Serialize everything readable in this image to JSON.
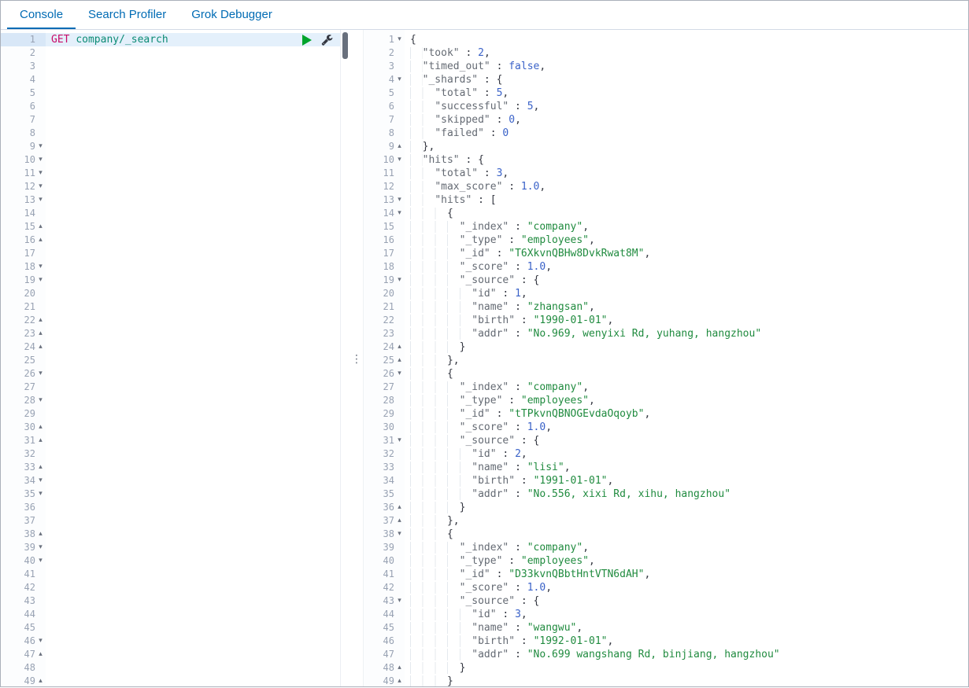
{
  "tabs": [
    {
      "label": "Console",
      "active": true
    },
    {
      "label": "Search Profiler",
      "active": false
    },
    {
      "label": "Grok Debugger",
      "active": false
    }
  ],
  "icons": {
    "grip": "⋮",
    "fold_down": "▾",
    "fold_up": "▴"
  },
  "colors": {
    "accent": "#006bb4",
    "border": "#d3dae6",
    "method": "#c80a68",
    "url": "#0c8b75",
    "key": "#646a73",
    "string": "#208b3f",
    "number": "#3a62c8",
    "bool": "#3a62c8",
    "punct": "#343741",
    "line_number": "#98a2b3",
    "fold": "#69707d",
    "active_line_bg": "#e4f0fb",
    "gutter_active_bg": "#d8e7f7",
    "play": "#00a42c",
    "icon": "#343741",
    "thumb": "#69707d",
    "indent_guide": "#e5e9ee"
  },
  "left_editor": {
    "line_count": 49,
    "active_line": 1,
    "request_tokens": [
      [
        "m",
        "GET"
      ],
      [
        "p",
        " "
      ],
      [
        "u",
        "company/_search"
      ]
    ],
    "folds": {
      "9": "down",
      "10": "down",
      "11": "down",
      "12": "down",
      "13": "down",
      "15": "up",
      "16": "up",
      "18": "down",
      "19": "down",
      "22": "up",
      "23": "up",
      "24": "up",
      "26": "down",
      "28": "down",
      "30": "up",
      "31": "up",
      "33": "up",
      "34": "down",
      "35": "down",
      "38": "up",
      "39": "down",
      "40": "down",
      "46": "down",
      "47": "up",
      "49": "up"
    }
  },
  "response": {
    "lines": [
      {
        "n": 1,
        "f": "down",
        "t": [
          [
            "p",
            "{"
          ]
        ]
      },
      {
        "n": 2,
        "t": [
          [
            "p",
            "  "
          ],
          [
            "k",
            "\"took\""
          ],
          [
            "p",
            " : "
          ],
          [
            "n",
            "2"
          ],
          [
            "p",
            ","
          ]
        ]
      },
      {
        "n": 3,
        "t": [
          [
            "p",
            "  "
          ],
          [
            "k",
            "\"timed_out\""
          ],
          [
            "p",
            " : "
          ],
          [
            "b",
            "false"
          ],
          [
            "p",
            ","
          ]
        ]
      },
      {
        "n": 4,
        "f": "down",
        "t": [
          [
            "p",
            "  "
          ],
          [
            "k",
            "\"_shards\""
          ],
          [
            "p",
            " : {"
          ]
        ]
      },
      {
        "n": 5,
        "t": [
          [
            "p",
            "    "
          ],
          [
            "k",
            "\"total\""
          ],
          [
            "p",
            " : "
          ],
          [
            "n",
            "5"
          ],
          [
            "p",
            ","
          ]
        ]
      },
      {
        "n": 6,
        "t": [
          [
            "p",
            "    "
          ],
          [
            "k",
            "\"successful\""
          ],
          [
            "p",
            " : "
          ],
          [
            "n",
            "5"
          ],
          [
            "p",
            ","
          ]
        ]
      },
      {
        "n": 7,
        "t": [
          [
            "p",
            "    "
          ],
          [
            "k",
            "\"skipped\""
          ],
          [
            "p",
            " : "
          ],
          [
            "n",
            "0"
          ],
          [
            "p",
            ","
          ]
        ]
      },
      {
        "n": 8,
        "t": [
          [
            "p",
            "    "
          ],
          [
            "k",
            "\"failed\""
          ],
          [
            "p",
            " : "
          ],
          [
            "n",
            "0"
          ]
        ]
      },
      {
        "n": 9,
        "f": "up",
        "t": [
          [
            "p",
            "  },"
          ]
        ]
      },
      {
        "n": 10,
        "f": "down",
        "t": [
          [
            "p",
            "  "
          ],
          [
            "k",
            "\"hits\""
          ],
          [
            "p",
            " : {"
          ]
        ]
      },
      {
        "n": 11,
        "t": [
          [
            "p",
            "    "
          ],
          [
            "k",
            "\"total\""
          ],
          [
            "p",
            " : "
          ],
          [
            "n",
            "3"
          ],
          [
            "p",
            ","
          ]
        ]
      },
      {
        "n": 12,
        "t": [
          [
            "p",
            "    "
          ],
          [
            "k",
            "\"max_score\""
          ],
          [
            "p",
            " : "
          ],
          [
            "n",
            "1.0"
          ],
          [
            "p",
            ","
          ]
        ]
      },
      {
        "n": 13,
        "f": "down",
        "t": [
          [
            "p",
            "    "
          ],
          [
            "k",
            "\"hits\""
          ],
          [
            "p",
            " : ["
          ]
        ]
      },
      {
        "n": 14,
        "f": "down",
        "t": [
          [
            "p",
            "      {"
          ]
        ]
      },
      {
        "n": 15,
        "t": [
          [
            "p",
            "        "
          ],
          [
            "k",
            "\"_index\""
          ],
          [
            "p",
            " : "
          ],
          [
            "s",
            "\"company\""
          ],
          [
            "p",
            ","
          ]
        ]
      },
      {
        "n": 16,
        "t": [
          [
            "p",
            "        "
          ],
          [
            "k",
            "\"_type\""
          ],
          [
            "p",
            " : "
          ],
          [
            "s",
            "\"employees\""
          ],
          [
            "p",
            ","
          ]
        ]
      },
      {
        "n": 17,
        "t": [
          [
            "p",
            "        "
          ],
          [
            "k",
            "\"_id\""
          ],
          [
            "p",
            " : "
          ],
          [
            "s",
            "\"T6XkvnQBHw8DvkRwat8M\""
          ],
          [
            "p",
            ","
          ]
        ]
      },
      {
        "n": 18,
        "t": [
          [
            "p",
            "        "
          ],
          [
            "k",
            "\"_score\""
          ],
          [
            "p",
            " : "
          ],
          [
            "n",
            "1.0"
          ],
          [
            "p",
            ","
          ]
        ]
      },
      {
        "n": 19,
        "f": "down",
        "t": [
          [
            "p",
            "        "
          ],
          [
            "k",
            "\"_source\""
          ],
          [
            "p",
            " : {"
          ]
        ]
      },
      {
        "n": 20,
        "t": [
          [
            "p",
            "          "
          ],
          [
            "k",
            "\"id\""
          ],
          [
            "p",
            " : "
          ],
          [
            "n",
            "1"
          ],
          [
            "p",
            ","
          ]
        ]
      },
      {
        "n": 21,
        "t": [
          [
            "p",
            "          "
          ],
          [
            "k",
            "\"name\""
          ],
          [
            "p",
            " : "
          ],
          [
            "s",
            "\"zhangsan\""
          ],
          [
            "p",
            ","
          ]
        ]
      },
      {
        "n": 22,
        "t": [
          [
            "p",
            "          "
          ],
          [
            "k",
            "\"birth\""
          ],
          [
            "p",
            " : "
          ],
          [
            "s",
            "\"1990-01-01\""
          ],
          [
            "p",
            ","
          ]
        ]
      },
      {
        "n": 23,
        "t": [
          [
            "p",
            "          "
          ],
          [
            "k",
            "\"addr\""
          ],
          [
            "p",
            " : "
          ],
          [
            "s",
            "\"No.969, wenyixi Rd, yuhang, hangzhou\""
          ]
        ]
      },
      {
        "n": 24,
        "f": "up",
        "t": [
          [
            "p",
            "        }"
          ]
        ]
      },
      {
        "n": 25,
        "f": "up",
        "t": [
          [
            "p",
            "      },"
          ]
        ]
      },
      {
        "n": 26,
        "f": "down",
        "t": [
          [
            "p",
            "      {"
          ]
        ]
      },
      {
        "n": 27,
        "t": [
          [
            "p",
            "        "
          ],
          [
            "k",
            "\"_index\""
          ],
          [
            "p",
            " : "
          ],
          [
            "s",
            "\"company\""
          ],
          [
            "p",
            ","
          ]
        ]
      },
      {
        "n": 28,
        "t": [
          [
            "p",
            "        "
          ],
          [
            "k",
            "\"_type\""
          ],
          [
            "p",
            " : "
          ],
          [
            "s",
            "\"employees\""
          ],
          [
            "p",
            ","
          ]
        ]
      },
      {
        "n": 29,
        "t": [
          [
            "p",
            "        "
          ],
          [
            "k",
            "\"_id\""
          ],
          [
            "p",
            " : "
          ],
          [
            "s",
            "\"tTPkvnQBNOGEvdaOqoyb\""
          ],
          [
            "p",
            ","
          ]
        ]
      },
      {
        "n": 30,
        "t": [
          [
            "p",
            "        "
          ],
          [
            "k",
            "\"_score\""
          ],
          [
            "p",
            " : "
          ],
          [
            "n",
            "1.0"
          ],
          [
            "p",
            ","
          ]
        ]
      },
      {
        "n": 31,
        "f": "down",
        "t": [
          [
            "p",
            "        "
          ],
          [
            "k",
            "\"_source\""
          ],
          [
            "p",
            " : {"
          ]
        ]
      },
      {
        "n": 32,
        "t": [
          [
            "p",
            "          "
          ],
          [
            "k",
            "\"id\""
          ],
          [
            "p",
            " : "
          ],
          [
            "n",
            "2"
          ],
          [
            "p",
            ","
          ]
        ]
      },
      {
        "n": 33,
        "t": [
          [
            "p",
            "          "
          ],
          [
            "k",
            "\"name\""
          ],
          [
            "p",
            " : "
          ],
          [
            "s",
            "\"lisi\""
          ],
          [
            "p",
            ","
          ]
        ]
      },
      {
        "n": 34,
        "t": [
          [
            "p",
            "          "
          ],
          [
            "k",
            "\"birth\""
          ],
          [
            "p",
            " : "
          ],
          [
            "s",
            "\"1991-01-01\""
          ],
          [
            "p",
            ","
          ]
        ]
      },
      {
        "n": 35,
        "t": [
          [
            "p",
            "          "
          ],
          [
            "k",
            "\"addr\""
          ],
          [
            "p",
            " : "
          ],
          [
            "s",
            "\"No.556, xixi Rd, xihu, hangzhou\""
          ]
        ]
      },
      {
        "n": 36,
        "f": "up",
        "t": [
          [
            "p",
            "        }"
          ]
        ]
      },
      {
        "n": 37,
        "f": "up",
        "t": [
          [
            "p",
            "      },"
          ]
        ]
      },
      {
        "n": 38,
        "f": "down",
        "t": [
          [
            "p",
            "      {"
          ]
        ]
      },
      {
        "n": 39,
        "t": [
          [
            "p",
            "        "
          ],
          [
            "k",
            "\"_index\""
          ],
          [
            "p",
            " : "
          ],
          [
            "s",
            "\"company\""
          ],
          [
            "p",
            ","
          ]
        ]
      },
      {
        "n": 40,
        "t": [
          [
            "p",
            "        "
          ],
          [
            "k",
            "\"_type\""
          ],
          [
            "p",
            " : "
          ],
          [
            "s",
            "\"employees\""
          ],
          [
            "p",
            ","
          ]
        ]
      },
      {
        "n": 41,
        "t": [
          [
            "p",
            "        "
          ],
          [
            "k",
            "\"_id\""
          ],
          [
            "p",
            " : "
          ],
          [
            "s",
            "\"D33kvnQBbtHntVTN6dAH\""
          ],
          [
            "p",
            ","
          ]
        ]
      },
      {
        "n": 42,
        "t": [
          [
            "p",
            "        "
          ],
          [
            "k",
            "\"_score\""
          ],
          [
            "p",
            " : "
          ],
          [
            "n",
            "1.0"
          ],
          [
            "p",
            ","
          ]
        ]
      },
      {
        "n": 43,
        "f": "down",
        "t": [
          [
            "p",
            "        "
          ],
          [
            "k",
            "\"_source\""
          ],
          [
            "p",
            " : {"
          ]
        ]
      },
      {
        "n": 44,
        "t": [
          [
            "p",
            "          "
          ],
          [
            "k",
            "\"id\""
          ],
          [
            "p",
            " : "
          ],
          [
            "n",
            "3"
          ],
          [
            "p",
            ","
          ]
        ]
      },
      {
        "n": 45,
        "t": [
          [
            "p",
            "          "
          ],
          [
            "k",
            "\"name\""
          ],
          [
            "p",
            " : "
          ],
          [
            "s",
            "\"wangwu\""
          ],
          [
            "p",
            ","
          ]
        ]
      },
      {
        "n": 46,
        "t": [
          [
            "p",
            "          "
          ],
          [
            "k",
            "\"birth\""
          ],
          [
            "p",
            " : "
          ],
          [
            "s",
            "\"1992-01-01\""
          ],
          [
            "p",
            ","
          ]
        ]
      },
      {
        "n": 47,
        "t": [
          [
            "p",
            "          "
          ],
          [
            "k",
            "\"addr\""
          ],
          [
            "p",
            " : "
          ],
          [
            "s",
            "\"No.699 wangshang Rd, binjiang, hangzhou\""
          ]
        ]
      },
      {
        "n": 48,
        "f": "up",
        "t": [
          [
            "p",
            "        }"
          ]
        ]
      },
      {
        "n": 49,
        "f": "up",
        "t": [
          [
            "p",
            "      }"
          ]
        ]
      }
    ]
  }
}
